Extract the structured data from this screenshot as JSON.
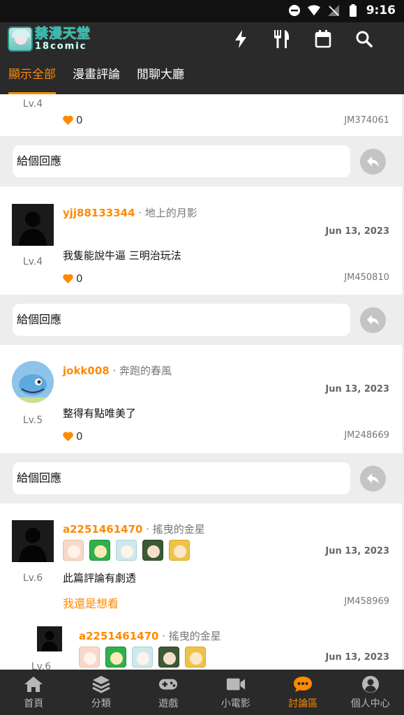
{
  "status_bar": {
    "time": "9:16",
    "icons": [
      "do-not-disturb-icon",
      "wifi-icon",
      "no-signal-icon",
      "battery-icon"
    ]
  },
  "header": {
    "logo_cn": "禁漫天堂",
    "logo_en": "18comic",
    "icons": [
      "flash-icon",
      "fork-knife-icon",
      "calendar-icon",
      "search-icon"
    ],
    "tabs": [
      {
        "label": "顯示全部",
        "active": true
      },
      {
        "label": "漫畫評論",
        "active": false
      },
      {
        "label": "閒聊大廳",
        "active": false
      }
    ]
  },
  "reply_placeholder": "給個回應",
  "comments": [
    {
      "level": "Lv.4",
      "likes": "0",
      "jm_id": "JM374061"
    },
    {
      "username": "yjj88133344",
      "title": " · 地上的月影",
      "date": "Jun 13, 2023",
      "level": "Lv.4",
      "text": "我隻能說牛逼 三明治玩法",
      "likes": "0",
      "jm_id": "JM450810"
    },
    {
      "username": "jokk008",
      "title": " · 奔跑的春風",
      "date": "Jun 13, 2023",
      "level": "Lv.5",
      "text": "整得有點唯美了",
      "likes": "0",
      "jm_id": "JM248669"
    },
    {
      "username": "a2251461470",
      "title": " · 搖曳的金星",
      "date": "Jun 13, 2023",
      "level": "Lv.6",
      "text": "此篇評論有劇透",
      "spoiler_link": "我還是想看",
      "jm_id": "JM458969"
    },
    {
      "username": "a2251461470",
      "title": " · 搖曳的金星",
      "date": "Jun 13, 2023",
      "level": "Lv.6"
    }
  ],
  "bottom_nav": [
    {
      "label": "首頁",
      "icon": "home-icon",
      "active": false
    },
    {
      "label": "分類",
      "icon": "layers-icon",
      "active": false
    },
    {
      "label": "遊戲",
      "icon": "gamepad-icon",
      "active": false
    },
    {
      "label": "小電影",
      "icon": "video-camera-icon",
      "active": false
    },
    {
      "label": "討論區",
      "icon": "chat-bubble-icon",
      "active": true
    },
    {
      "label": "個人中心",
      "icon": "user-circle-icon",
      "active": false
    }
  ],
  "colors": {
    "accent": "#ff8a00",
    "header_bg": "#2a2a2a",
    "page_bg": "#ededed"
  }
}
